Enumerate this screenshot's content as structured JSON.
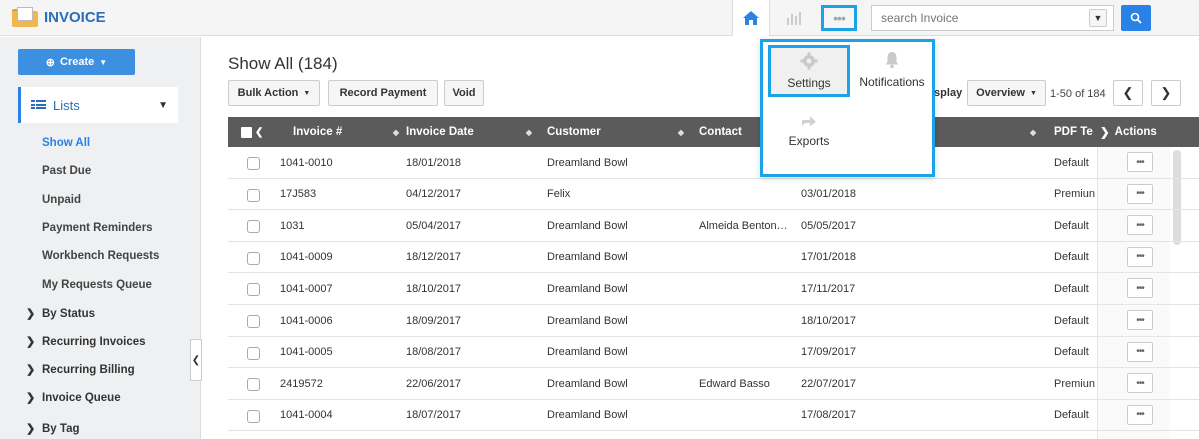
{
  "app": {
    "title": "INVOICE"
  },
  "search": {
    "placeholder": "search Invoice"
  },
  "sidebar": {
    "create_label": "Create",
    "lists_label": "Lists",
    "items": [
      "Show All",
      "Past Due",
      "Unpaid",
      "Payment Reminders",
      "Workbench Requests",
      "My Requests Queue"
    ],
    "groups": [
      "By Status",
      "Recurring Invoices",
      "Recurring Billing",
      "Invoice Queue",
      "By Tag"
    ]
  },
  "main": {
    "heading": "Show All (184)",
    "toolbar": {
      "bulk_action": "Bulk Action",
      "record_payment": "Record Payment",
      "void": "Void"
    },
    "display_label": "isplay",
    "view_select": "Overview",
    "pager": "1-50 of 184"
  },
  "table": {
    "columns": [
      "Invoice #",
      "Invoice Date",
      "Customer",
      "Contact",
      "PDF Te",
      "Actions"
    ],
    "rows": [
      {
        "invoice": "1041-0010",
        "date": "18/01/2018",
        "customer": "Dreamland Bowl",
        "contact": "",
        "due": "",
        "pdf": "Default"
      },
      {
        "invoice": "17J583",
        "date": "04/12/2017",
        "customer": "Felix",
        "contact": "",
        "due": "03/01/2018",
        "pdf": "Premiun"
      },
      {
        "invoice": "1031",
        "date": "05/04/2017",
        "customer": "Dreamland Bowl",
        "contact": "Almeida Benton…",
        "due": "05/05/2017",
        "pdf": "Default"
      },
      {
        "invoice": "1041-0009",
        "date": "18/12/2017",
        "customer": "Dreamland Bowl",
        "contact": "",
        "due": "17/01/2018",
        "pdf": "Default"
      },
      {
        "invoice": "1041-0007",
        "date": "18/10/2017",
        "customer": "Dreamland Bowl",
        "contact": "",
        "due": "17/11/2017",
        "pdf": "Default"
      },
      {
        "invoice": "1041-0006",
        "date": "18/09/2017",
        "customer": "Dreamland Bowl",
        "contact": "",
        "due": "18/10/2017",
        "pdf": "Default"
      },
      {
        "invoice": "1041-0005",
        "date": "18/08/2017",
        "customer": "Dreamland Bowl",
        "contact": "",
        "due": "17/09/2017",
        "pdf": "Default"
      },
      {
        "invoice": "2419572",
        "date": "22/06/2017",
        "customer": "Dreamland Bowl",
        "contact": "Edward Basso",
        "due": "22/07/2017",
        "pdf": "Premiun"
      },
      {
        "invoice": "1041-0004",
        "date": "18/07/2017",
        "customer": "Dreamland Bowl",
        "contact": "",
        "due": "17/08/2017",
        "pdf": "Default"
      }
    ],
    "action_glyph": "•••"
  },
  "popup": {
    "settings": "Settings",
    "notifications": "Notifications",
    "exports": "Exports"
  },
  "colors": {
    "accent": "#2a82e6",
    "highlight": "#1aa3e8",
    "header_bg": "#5b5b5b"
  }
}
